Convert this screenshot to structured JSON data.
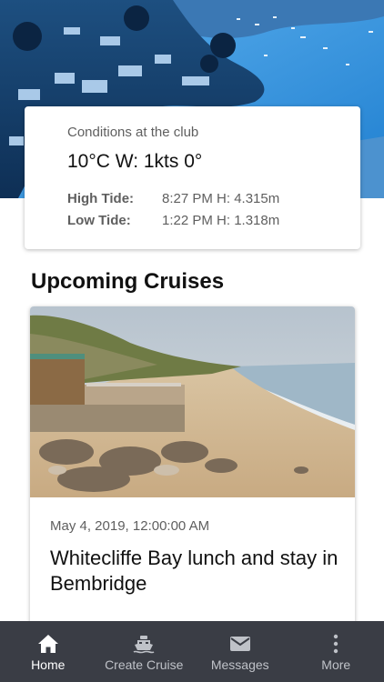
{
  "conditions": {
    "title": "Conditions at the club",
    "weather": "10°C W: 1kts 0°",
    "high_tide": {
      "label": "High Tide:",
      "value": "8:27 PM H: 4.315m"
    },
    "low_tide": {
      "label": "Low Tide:",
      "value": "1:22 PM H: 1.318m"
    }
  },
  "upcoming": {
    "heading": "Upcoming Cruises",
    "cruises": [
      {
        "date": "May 4, 2019, 12:00:00 AM",
        "title": "Whitecliffe Bay lunch and stay in Bembridge"
      }
    ]
  },
  "tab_bar": {
    "tabs": [
      {
        "label": "Home",
        "icon": "home-icon",
        "active": true
      },
      {
        "label": "Create Cruise",
        "icon": "boat-icon",
        "active": false
      },
      {
        "label": "Messages",
        "icon": "envelope-icon",
        "active": false
      },
      {
        "label": "More",
        "icon": "more-vertical-icon",
        "active": false
      }
    ]
  },
  "colors": {
    "tab_bar_bg": "#3a3d45",
    "hero_tint": "#1f7fd0"
  }
}
